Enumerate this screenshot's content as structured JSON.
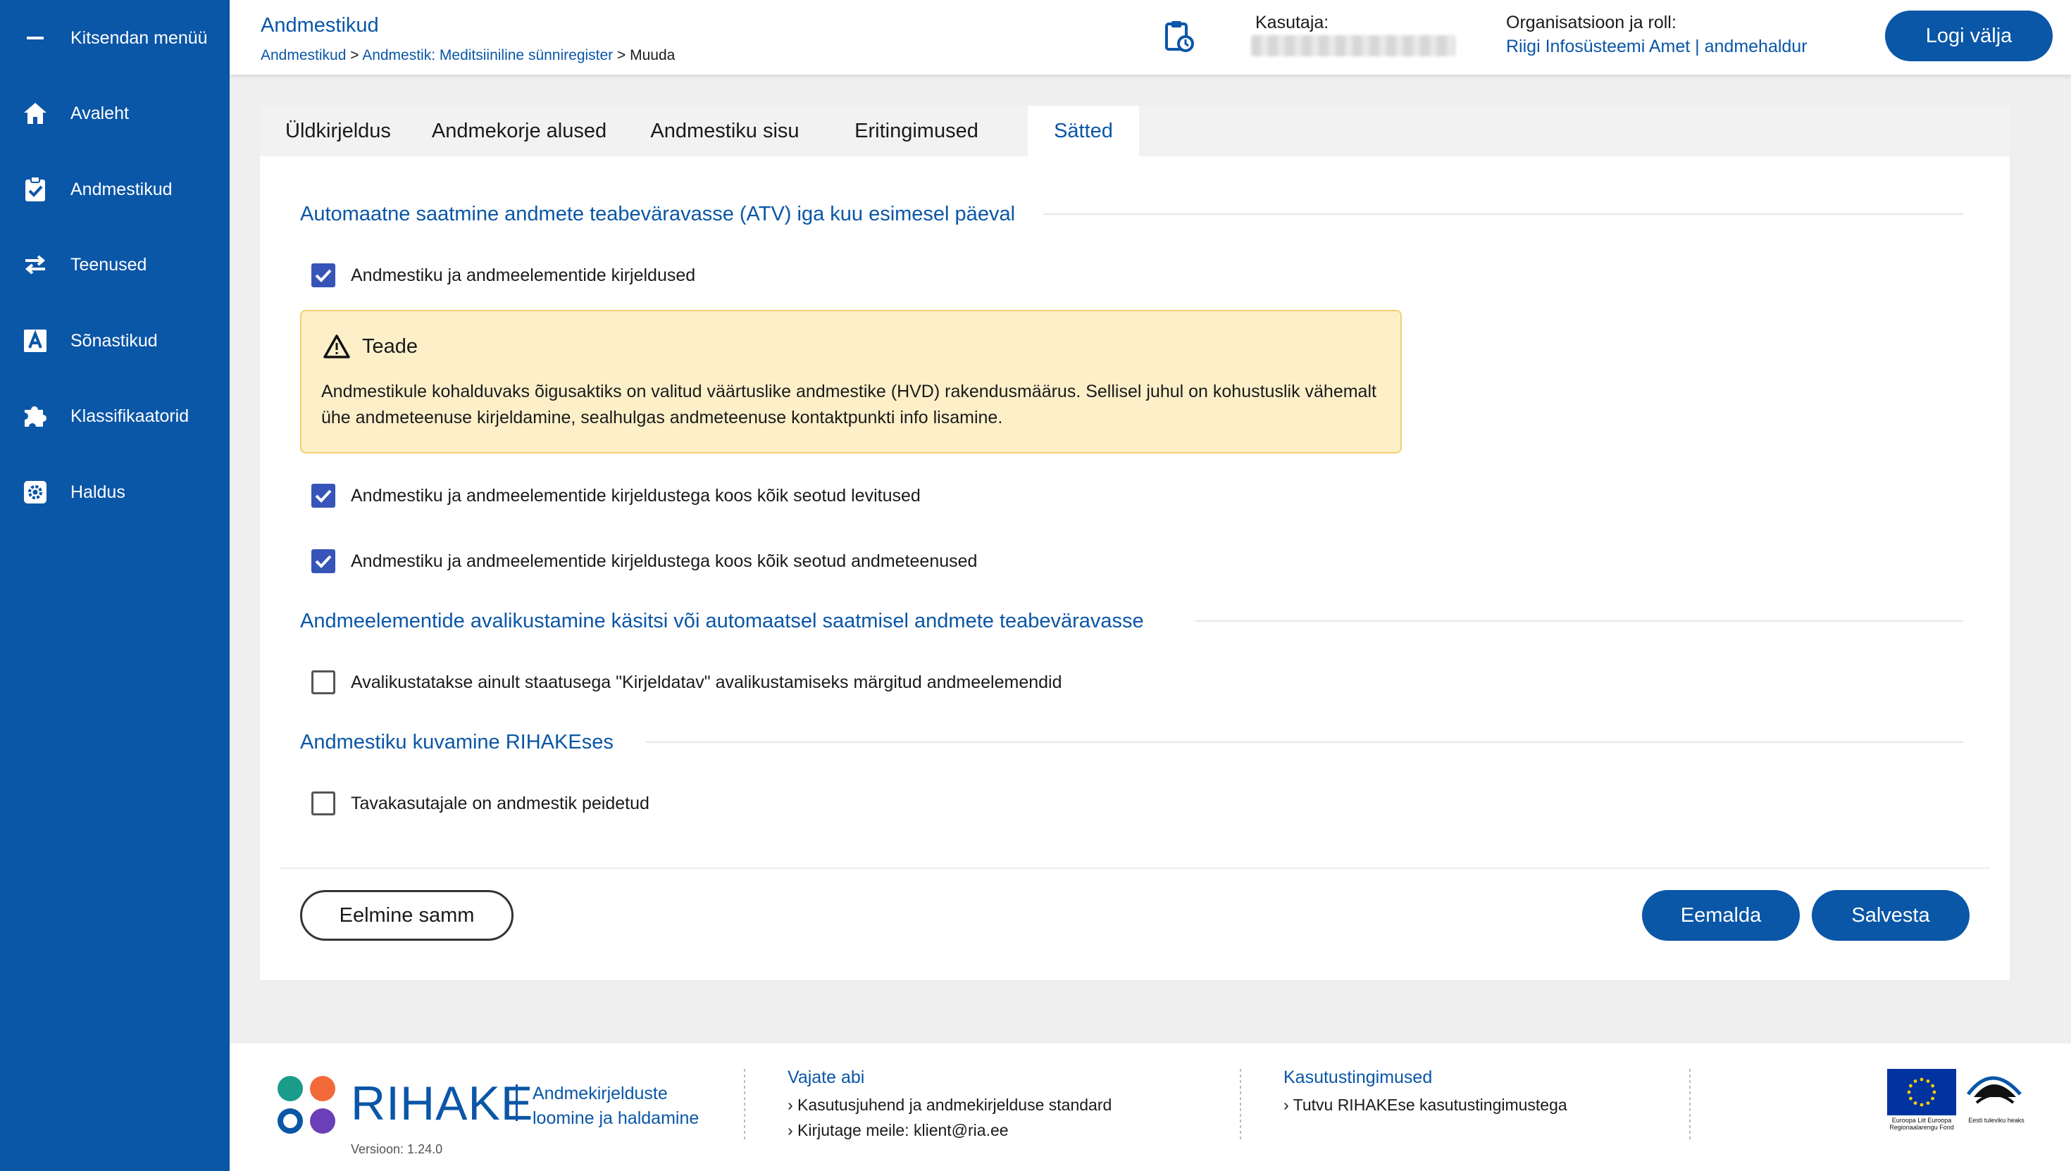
{
  "sidebar": {
    "collapse_label": "Kitsendan menüü",
    "items": [
      {
        "label": "Avaleht"
      },
      {
        "label": "Andmestikud"
      },
      {
        "label": "Teenused"
      },
      {
        "label": "Sõnastikud"
      },
      {
        "label": "Klassifikaatorid"
      },
      {
        "label": "Haldus"
      }
    ]
  },
  "header": {
    "title": "Andmestikud",
    "breadcrumb": {
      "item1": "Andmestikud",
      "sep1": " > ",
      "item2": "Andmestik: Meditsiiniline sünniregister",
      "sep2": " > ",
      "current": "Muuda"
    },
    "user_label": "Kasutaja:",
    "org_label": "Organisatsioon ja roll:",
    "org_value": "Riigi Infosüsteemi Amet | andmehaldur",
    "logout_label": "Logi välja"
  },
  "tabs": [
    {
      "label": "Üldkirjeldus",
      "active": false
    },
    {
      "label": "Andmekorje alused",
      "active": false
    },
    {
      "label": "Andmestiku sisu",
      "active": false
    },
    {
      "label": "Eritingimused",
      "active": false
    },
    {
      "label": "Sätted",
      "active": true
    }
  ],
  "sections": {
    "atv": {
      "title": "Automaatne saatmine andmete teabeväravasse (ATV) iga kuu esimesel päeval",
      "options": [
        {
          "label": "Andmestiku ja andmeelementide kirjeldused",
          "checked": true
        },
        {
          "label": "Andmestiku ja andmeelementide kirjeldustega koos kõik seotud levitused",
          "checked": true
        },
        {
          "label": "Andmestiku ja andmeelementide kirjeldustega koos kõik seotud andmeteenused",
          "checked": true
        }
      ]
    },
    "notice": {
      "title": "Teade",
      "text": "Andmestikule kohalduvaks õigusaktiks on valitud väärtuslike andmestike (HVD) rakendusmäärus. Sellisel juhul on kohustuslik vähemalt ühe andmeteenuse kirjeldamine, sealhulgas andmeteenuse kontaktpunkti info lisamine."
    },
    "publish": {
      "title": "Andmeelementide avalikustamine käsitsi või automaatsel saatmisel andmete teabeväravasse",
      "options": [
        {
          "label": "Avalikustatakse ainult staatusega \"Kirjeldatav\" avalikustamiseks märgitud andmeelemendid",
          "checked": false
        }
      ]
    },
    "display": {
      "title": "Andmestiku kuvamine RIHAKEses",
      "options": [
        {
          "label": "Tavakasutajale on andmestik peidetud",
          "checked": false
        }
      ]
    }
  },
  "actions": {
    "previous_label": "Eelmine samm",
    "remove_label": "Eemalda",
    "save_label": "Salvesta"
  },
  "footer": {
    "brand": "RIHAKE",
    "brand_sub_line1": "Andmekirjelduste",
    "brand_sub_line2": "loomine ja haldamine",
    "version": "Versioon: 1.24.0",
    "help_title": "Vajate abi",
    "help_link1": "› Kasutusjuhend ja andmekirjelduse standard",
    "help_link2_prefix": "› Kirjutage meile: ",
    "help_link2_email": "klient@ria.ee",
    "terms_title": "Kasutustingimused",
    "terms_link": "› Tutvu RIHAKEse kasutustingimustega",
    "eu_text": "Euroopa Liit Euroopa Regionaalarengu Fond",
    "est_text": "Eesti tuleviku heaks"
  },
  "colors": {
    "primary": "#0a56a7",
    "checkbox": "#3754b8",
    "notice_bg": "#fdf0c9",
    "notice_border": "#f3cf74"
  }
}
